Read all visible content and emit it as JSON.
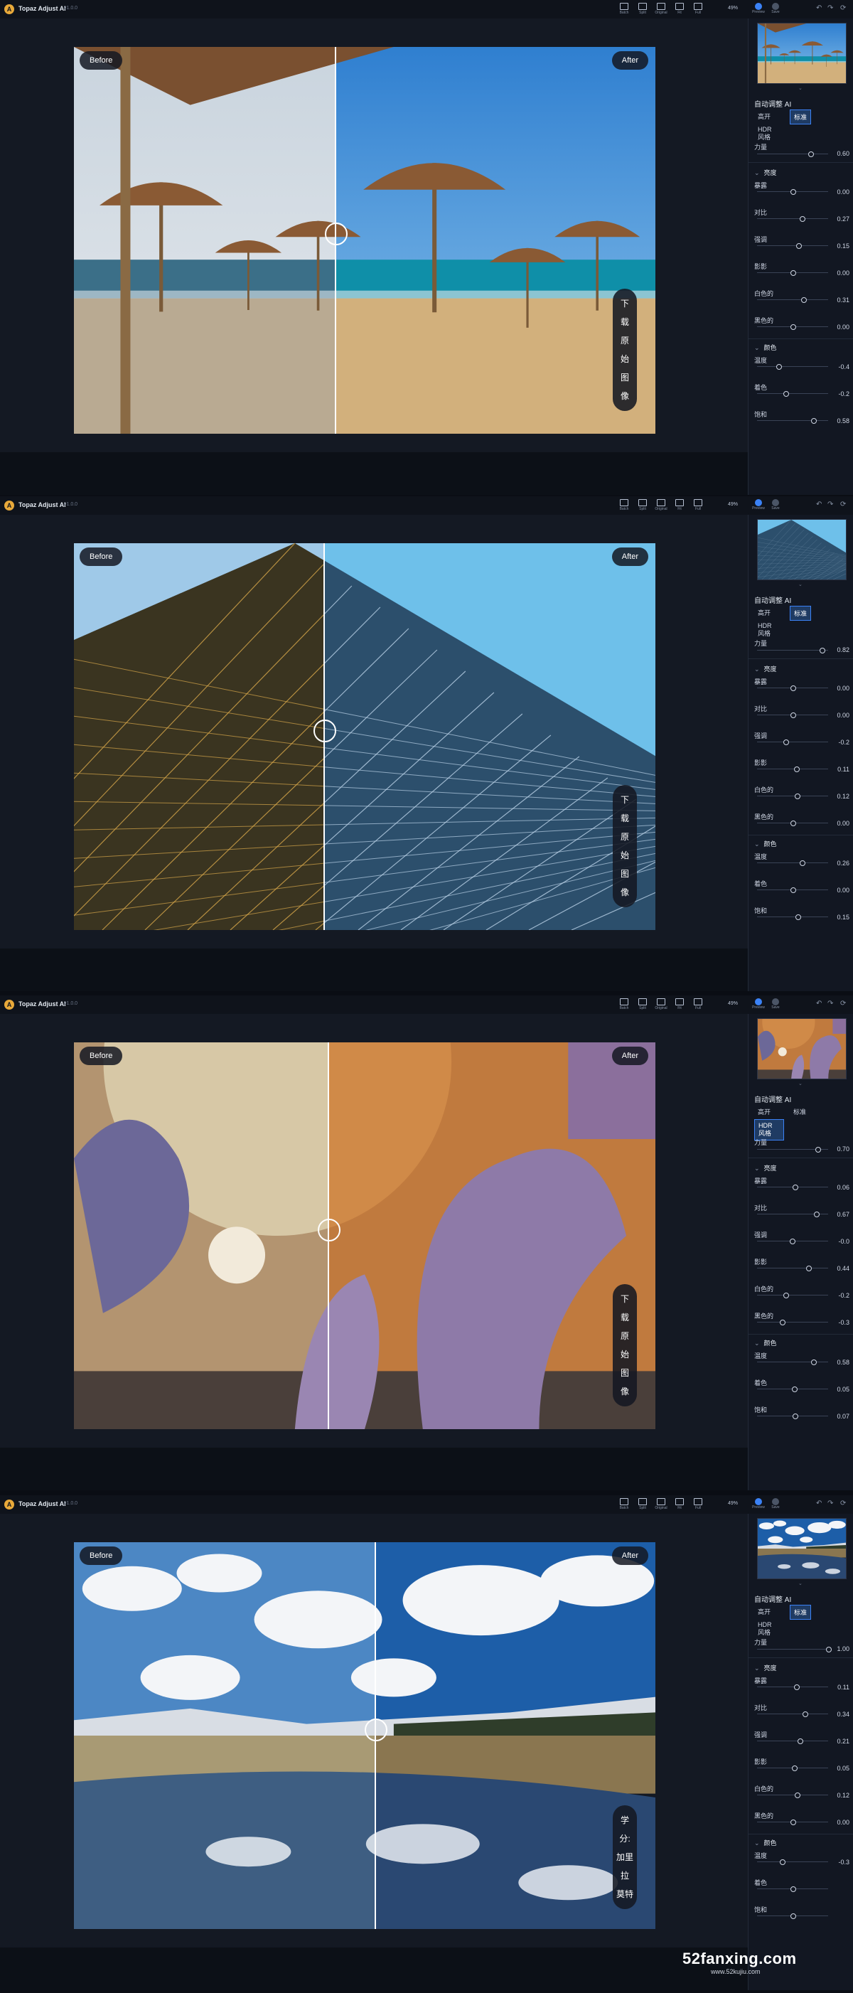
{
  "app": {
    "title": "Topaz Adjust AI",
    "version": "v1.0.0"
  },
  "toolbar": {
    "icons": [
      "Batch",
      "Split",
      "Original",
      "Fit",
      "Full"
    ],
    "zoom": "49%",
    "right": [
      "Preview",
      "Save"
    ]
  },
  "labels": {
    "before": "Before",
    "after": "After"
  },
  "sidebar_labels": {
    "auto": "自动调整 AI",
    "mode_a": "高开",
    "mode_b": "标准",
    "hdr": "HDR 风格",
    "strength": "力量",
    "brightness_group": "亮度",
    "color_group": "颜色",
    "exposure": "暴露",
    "contrast": "对比",
    "highlights": "强调",
    "shadows": "影影",
    "whites": "白色的",
    "blacks": "黑色的",
    "temperature": "温度",
    "tint": "着色",
    "saturation": "饱和"
  },
  "panels": [
    {
      "scene": "beach",
      "overlay": [
        "下",
        "载",
        "原",
        "始",
        "图",
        "像"
      ],
      "active_mode": "b",
      "strength": "0.60",
      "values": {
        "exposure": "0.00",
        "contrast": "0.27",
        "highlights": "0.15",
        "shadows": "0.00",
        "whites": "0.31",
        "blacks": "0.00",
        "temperature": "-0.4",
        "tint": "-0.2",
        "saturation": "0.58"
      },
      "knobs": {
        "strength": 0.75,
        "exposure": 0.5,
        "contrast": 0.63,
        "highlights": 0.58,
        "shadows": 0.5,
        "whites": 0.65,
        "blacks": 0.5,
        "temperature": 0.3,
        "tint": 0.4,
        "saturation": 0.79
      }
    },
    {
      "scene": "pyramid",
      "overlay": [
        "下",
        "载",
        "原",
        "始",
        "图",
        "像"
      ],
      "active_mode": "b",
      "strength": "0.82",
      "values": {
        "exposure": "0.00",
        "contrast": "0.00",
        "highlights": "-0.2",
        "shadows": "0.11",
        "whites": "0.12",
        "blacks": "0.00",
        "temperature": "0.26",
        "tint": "0.00",
        "saturation": "0.15"
      },
      "knobs": {
        "strength": 0.91,
        "exposure": 0.5,
        "contrast": 0.5,
        "highlights": 0.4,
        "shadows": 0.55,
        "whites": 0.56,
        "blacks": 0.5,
        "temperature": 0.63,
        "tint": 0.5,
        "saturation": 0.57
      }
    },
    {
      "scene": "dome",
      "overlay": [
        "下",
        "载",
        "原",
        "始",
        "图",
        "像"
      ],
      "active_mode": "hdr",
      "strength": "0.70",
      "values": {
        "exposure": "0.06",
        "contrast": "0.67",
        "highlights": "-0.0",
        "shadows": "0.44",
        "whites": "-0.2",
        "blacks": "-0.3",
        "temperature": "0.58",
        "tint": "0.05",
        "saturation": "0.07"
      },
      "knobs": {
        "strength": 0.85,
        "exposure": 0.53,
        "contrast": 0.83,
        "highlights": 0.49,
        "shadows": 0.72,
        "whites": 0.4,
        "blacks": 0.35,
        "temperature": 0.79,
        "tint": 0.52,
        "saturation": 0.53
      }
    },
    {
      "scene": "lake",
      "overlay": [
        "学",
        "分:",
        "加里",
        "拉",
        "莫特"
      ],
      "active_mode": "b",
      "strength": "1.00",
      "values": {
        "exposure": "0.11",
        "contrast": "0.34",
        "highlights": "0.21",
        "shadows": "0.05",
        "whites": "0.12",
        "blacks": "0.00",
        "temperature": "-0.3",
        "tint": "",
        "saturation": ""
      },
      "knobs": {
        "strength": 1.0,
        "exposure": 0.55,
        "contrast": 0.67,
        "highlights": 0.6,
        "shadows": 0.52,
        "whites": 0.56,
        "blacks": 0.5,
        "temperature": 0.35,
        "tint": 0.5,
        "saturation": 0.5
      }
    }
  ],
  "watermark": {
    "big": "52fanxing.com",
    "small": "www.52kujiu.com"
  }
}
